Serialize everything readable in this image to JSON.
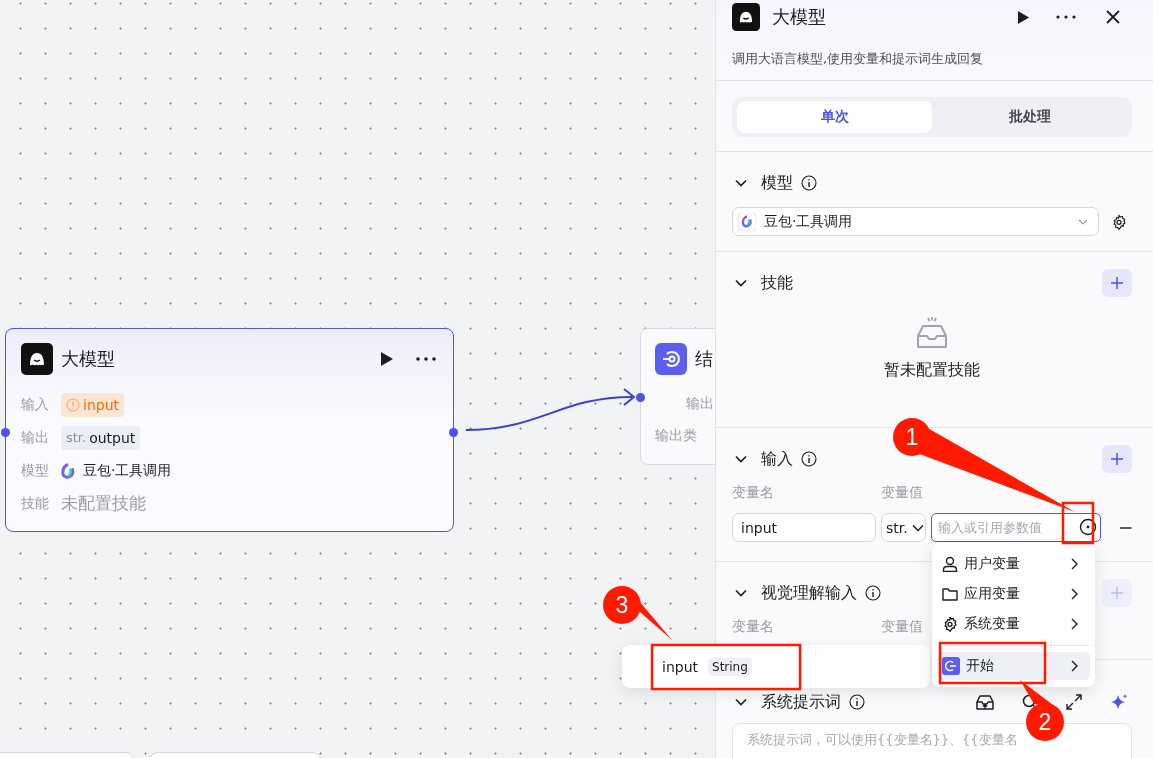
{
  "canvas": {
    "nodes": [
      {
        "kind": "llm",
        "title": "大模型",
        "rows": [
          {
            "label": "输入",
            "kind": "warning",
            "value": "input"
          },
          {
            "label": "输出",
            "kind": "typed",
            "type": "str.",
            "value": "output"
          },
          {
            "label": "模型",
            "kind": "model",
            "value": "豆包·工具调用"
          },
          {
            "label": "技能",
            "kind": "empty",
            "value": "未配置技能"
          }
        ]
      },
      {
        "kind": "end",
        "title": "结",
        "rows": [
          {
            "label": "输出",
            "kind": "right"
          },
          {
            "label": "输出类",
            "kind": "left"
          }
        ]
      }
    ]
  },
  "panel": {
    "title": "大模型",
    "description": "调用大语言模型,使用变量和提示词生成回复",
    "tabs": [
      {
        "label": "单次",
        "selected": true
      },
      {
        "label": "批处理",
        "selected": false
      }
    ],
    "model_section": {
      "title": "模型",
      "value": "豆包·工具调用"
    },
    "skills_section": {
      "title": "技能",
      "empty_text": "暂未配置技能"
    },
    "input_section": {
      "title": "输入",
      "columns": [
        "变量名",
        "变量值"
      ],
      "rows": [
        {
          "name": "input",
          "type": "str.",
          "placeholder": "输入或引用参数值"
        }
      ]
    },
    "vision_section": {
      "title": "视觉理解输入",
      "columns": [
        "变量名",
        "变量值"
      ],
      "add_disabled": true
    },
    "prompt_section": {
      "title": "系统提示词",
      "placeholder": "系统提示词，可以使用{{变量名}}、{{变量名"
    }
  },
  "reference_menu": {
    "items": [
      {
        "label": "用户变量",
        "kind": "user",
        "selected": false
      },
      {
        "label": "应用变量",
        "kind": "app",
        "selected": false
      },
      {
        "label": "系统变量",
        "kind": "system",
        "selected": false
      },
      {
        "label": "开始",
        "kind": "node",
        "selected": true
      }
    ]
  },
  "submenu": {
    "items": [
      {
        "name": "input",
        "type": "String"
      }
    ]
  },
  "annotations": [
    {
      "label": "1"
    },
    {
      "label": "2"
    },
    {
      "label": "3"
    }
  ]
}
